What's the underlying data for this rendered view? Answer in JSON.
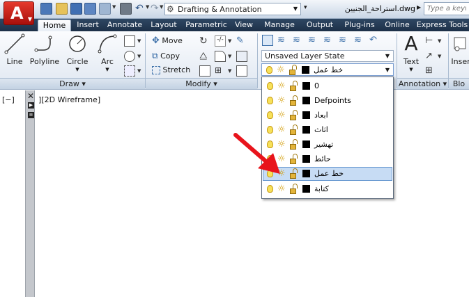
{
  "titlebar": {
    "workspace": "Drafting & Annotation",
    "document": "استراحة_الجنيين.dwg",
    "search_placeholder": "Type a keywor"
  },
  "tabs": [
    "Home",
    "Insert",
    "Annotate",
    "Layout",
    "Parametric",
    "View",
    "Manage",
    "Output",
    "Plug-ins",
    "Online",
    "Express Tools"
  ],
  "active_tab": "Home",
  "ribbon": {
    "draw": {
      "tools": [
        "Line",
        "Polyline",
        "Circle",
        "Arc"
      ],
      "footer": "Draw ▾"
    },
    "modify": {
      "tools": [
        "Move",
        "Copy",
        "Stretch"
      ],
      "footer": "Modify ▾"
    },
    "layers": {
      "state": "Unsaved Layer State",
      "current_layer": "خط عمل"
    },
    "annotation": {
      "tool": "Text",
      "footer": "Annotation ▾",
      "letter": "A"
    },
    "insert": {
      "tool": "Inser",
      "footer": "Blo"
    }
  },
  "layers_list": [
    {
      "name": "0",
      "selected": false
    },
    {
      "name": "Defpoints",
      "selected": false
    },
    {
      "name": "ابعاد",
      "selected": false
    },
    {
      "name": "اثاث",
      "selected": false
    },
    {
      "name": "تهشير",
      "selected": false
    },
    {
      "name": "حائط",
      "selected": false
    },
    {
      "name": "خط عمل",
      "selected": true
    },
    {
      "name": "كتابة",
      "selected": false
    }
  ],
  "canvas": {
    "viewport_control": "[−]",
    "view_label": "][2D Wireframe]"
  },
  "colors": {
    "tab_bar": "#2e4763",
    "app_button": "#d32a1f",
    "selection": "#c7dcf4",
    "annotation_arrow": "#e8141c"
  }
}
